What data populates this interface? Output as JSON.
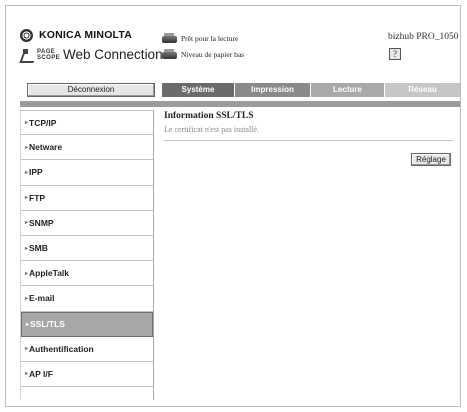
{
  "header": {
    "brand_name": "KONICA MINOLTA",
    "pagescope_line1": "PAGE",
    "pagescope_line2": "SCOPE",
    "web_connection": "Web Connection",
    "status_items": [
      {
        "label": "Prêt pour la lecture",
        "icon": "printer-ready-icon"
      },
      {
        "label": "Niveau de papier bas",
        "icon": "paper-tray-icon"
      }
    ],
    "model": "bizhub PRO_1050",
    "help_label": "?"
  },
  "toolbar": {
    "logout_label": "Déconnexion",
    "tabs": [
      {
        "label": "Système",
        "color": "#6b6b6b"
      },
      {
        "label": "Impression",
        "color": "#8a8a8a"
      },
      {
        "label": "Lecture",
        "color": "#a9a9a9"
      },
      {
        "label": "Réseau",
        "color": "#c6c6c6"
      }
    ]
  },
  "sidebar": {
    "items": [
      {
        "label": "TCP/IP"
      },
      {
        "label": "Netware"
      },
      {
        "label": "IPP"
      },
      {
        "label": "FTP"
      },
      {
        "label": "SNMP"
      },
      {
        "label": "SMB"
      },
      {
        "label": "AppleTalk"
      },
      {
        "label": "E-mail"
      },
      {
        "label": "SSL/TLS",
        "active": true
      },
      {
        "label": "Authentification"
      },
      {
        "label": "AP I/F"
      }
    ]
  },
  "main": {
    "title": "Information SSL/TLS",
    "message": "Le certificat n'est pas installé.",
    "settings_label": "Réglage"
  }
}
